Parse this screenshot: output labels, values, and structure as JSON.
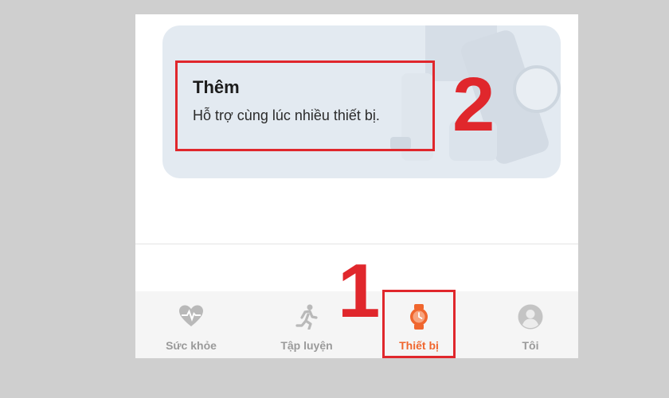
{
  "add_device_card": {
    "title": "Thêm",
    "subtitle": "Hỗ trợ cùng lúc nhiều thiết bị."
  },
  "annotations": {
    "step_card": "2",
    "step_tab": "1",
    "highlight_color": "#e0272c"
  },
  "tabbar": {
    "active_color": "#f0662e",
    "inactive_color": "#9a9a9a",
    "tabs": [
      {
        "label": "Sức khỏe",
        "icon": "heart-pulse-icon",
        "active": false
      },
      {
        "label": "Tập luyện",
        "icon": "running-person-icon",
        "active": false
      },
      {
        "label": "Thiết bị",
        "icon": "watch-icon",
        "active": true
      },
      {
        "label": "Tôi",
        "icon": "profile-icon",
        "active": false
      }
    ]
  }
}
